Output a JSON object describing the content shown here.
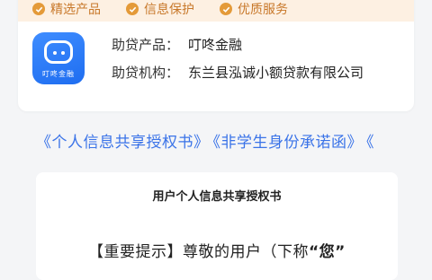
{
  "features": [
    {
      "label": "精选产品",
      "icon": "check-icon"
    },
    {
      "label": "信息保护",
      "icon": "check-icon"
    },
    {
      "label": "优质服务",
      "icon": "check-icon"
    }
  ],
  "product": {
    "logo_caption": "叮咚金融",
    "name_label": "助贷产品：",
    "name_value": "叮咚金融",
    "org_label": "助贷机构：",
    "org_value": "东兰县泓诚小额贷款有限公司"
  },
  "agreements": {
    "link_1": "《个人信息共享授权书》",
    "link_2": "《非学生身份承诺函》",
    "link_3": "《"
  },
  "document": {
    "title": "用户个人信息共享授权书",
    "tip_prefix": "【重要提示】尊敬的用户（下称",
    "tip_quote": "“您”"
  },
  "colors": {
    "accent_orange": "#e49a39",
    "link_blue": "#3a73e8",
    "logo_blue": "#2f7bff"
  }
}
